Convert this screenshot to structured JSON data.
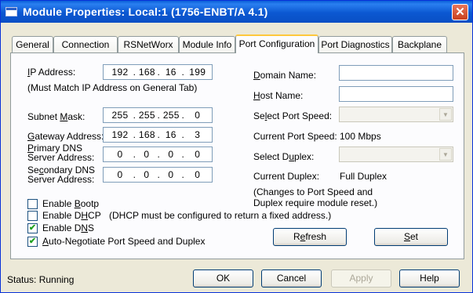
{
  "window": {
    "title": "Module Properties: Local:1 (1756-ENBT/A 4.1)",
    "close_symbol": "✕"
  },
  "tabs": [
    {
      "label": "General"
    },
    {
      "label": "Connection"
    },
    {
      "label": "RSNetWorx"
    },
    {
      "label": "Module Info"
    },
    {
      "label": "Port Configuration"
    },
    {
      "label": "Port Diagnostics"
    },
    {
      "label": "Backplane"
    }
  ],
  "active_tab": "Port Configuration",
  "left": {
    "ip_label": "IP Address:",
    "ip": [
      "192",
      "168",
      "16",
      "199"
    ],
    "ip_note": "(Must Match IP Address on General Tab)",
    "subnet_label": "Subnet Mask:",
    "subnet": [
      "255",
      "255",
      "255",
      "0"
    ],
    "gateway_label": "Gateway Address:",
    "gateway": [
      "192",
      "168",
      "16",
      "3"
    ],
    "primary_dns_label_1": "Primary DNS",
    "primary_dns_label_2": "Server Address:",
    "primary_dns": [
      "0",
      "0",
      "0",
      "0"
    ],
    "secondary_dns_label_1": "Secondary DNS",
    "secondary_dns_label_2": "Server Address:",
    "secondary_dns": [
      "0",
      "0",
      "0",
      "0"
    ]
  },
  "right": {
    "domain_label": "Domain Name:",
    "domain_value": "",
    "host_label": "Host Name:",
    "host_value": "",
    "select_speed_label": "Select Port Speed:",
    "current_speed_label": "Current Port Speed:",
    "current_speed_value": "100 Mbps",
    "select_duplex_label": "Select Duplex:",
    "current_duplex_label": "Current Duplex:",
    "current_duplex_value": "Full Duplex",
    "note_line1": "(Changes to Port Speed and",
    "note_line2": "Duplex require module reset.)"
  },
  "checkboxes": [
    {
      "label": "Enable Bootp",
      "checked": false
    },
    {
      "label": "Enable DHCP",
      "note": "(DHCP must be configured to return a fixed address.)",
      "checked": false
    },
    {
      "label": "Enable DNS",
      "checked": true
    },
    {
      "label": "Auto-Negotiate Port Speed and Duplex",
      "checked": true
    }
  ],
  "buttons": {
    "refresh": "Refresh",
    "set": "Set",
    "ok": "OK",
    "cancel": "Cancel",
    "apply": "Apply",
    "help": "Help"
  },
  "status": {
    "label": "Status:",
    "value": "Running"
  },
  "colors": {
    "title_bar": "#0a5fd8",
    "dialog_bg": "#ece9d8",
    "active_tab_accent": "#ffc83c",
    "checkmark": "#21a121"
  }
}
